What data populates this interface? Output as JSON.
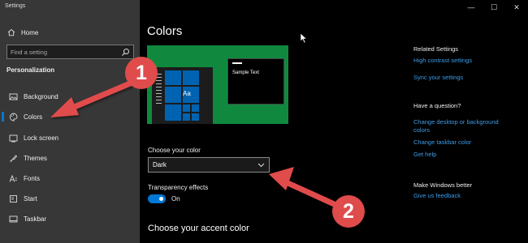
{
  "window": {
    "title": "Settings",
    "minimize": "—",
    "maximize": "☐",
    "close": "✕"
  },
  "sidebar": {
    "home_label": "Home",
    "search_placeholder": "Find a setting",
    "section": "Personalization",
    "items": [
      {
        "label": "Background",
        "icon": "image-icon"
      },
      {
        "label": "Colors",
        "icon": "palette-icon",
        "active": true
      },
      {
        "label": "Lock screen",
        "icon": "lock-screen-icon"
      },
      {
        "label": "Themes",
        "icon": "themes-icon"
      },
      {
        "label": "Fonts",
        "icon": "fonts-icon"
      },
      {
        "label": "Start",
        "icon": "start-icon"
      },
      {
        "label": "Taskbar",
        "icon": "taskbar-icon"
      }
    ]
  },
  "main": {
    "title": "Colors",
    "preview": {
      "sample_text": "Sample Text",
      "tile_text": "Aa"
    },
    "choose_color_label": "Choose your color",
    "choose_color_value": "Dark",
    "transparency_label": "Transparency effects",
    "transparency_state": "On",
    "accent_label": "Choose your accent color"
  },
  "right": {
    "related_heading": "Related Settings",
    "related_links": [
      "High contrast settings",
      "Sync your settings"
    ],
    "question_heading": "Have a question?",
    "question_links": [
      "Change desktop or background colors",
      "Change taskbar color",
      "Get help"
    ],
    "better_heading": "Make Windows better",
    "better_links": [
      "Give us feedback"
    ]
  },
  "annotations": {
    "badge1": "1",
    "badge2": "2"
  },
  "colors": {
    "sidebar_bg": "#373737",
    "accent": "#0078d7",
    "link": "#3c9ce8",
    "preview_bg": "#10893e",
    "arrow": "#e04b4b"
  }
}
